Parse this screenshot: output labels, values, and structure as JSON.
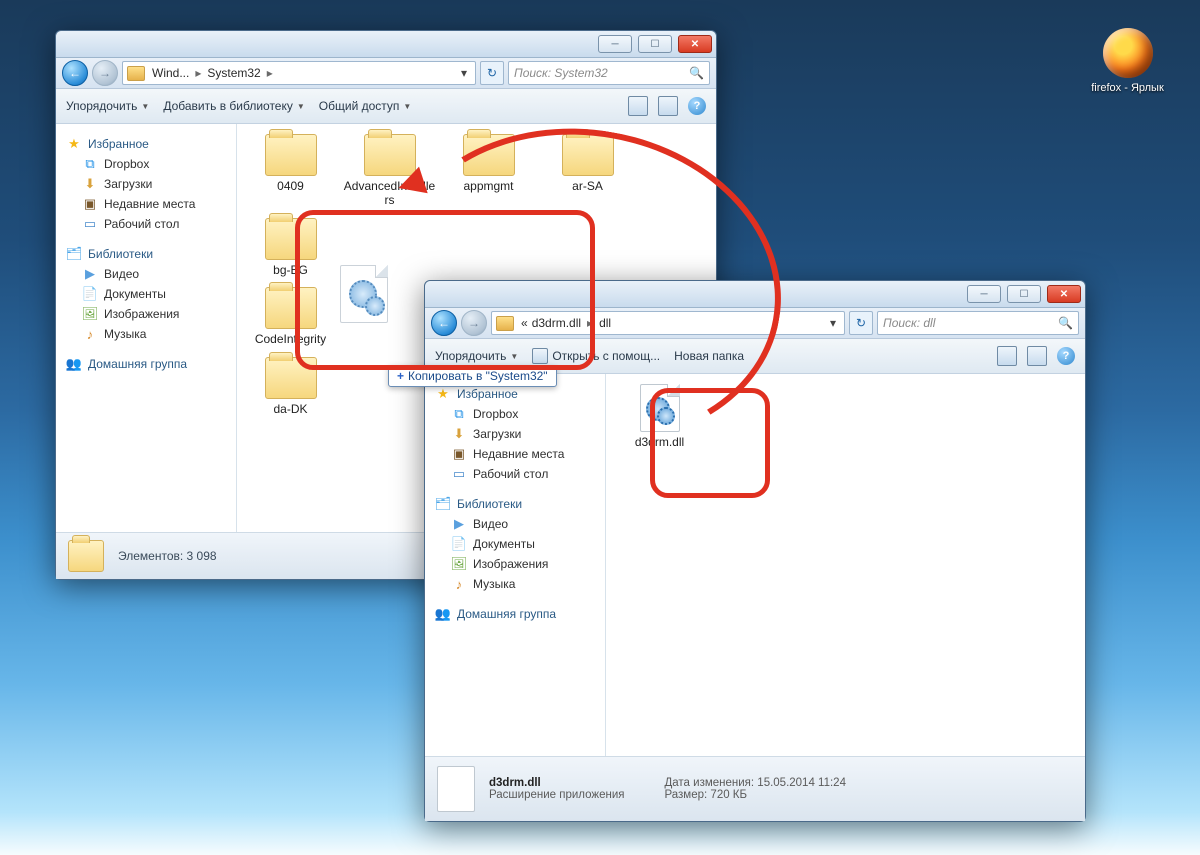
{
  "desktop": {
    "shortcut": {
      "label": "firefox -\nЯрлык"
    }
  },
  "annotation": {
    "copy_tip": "Копировать в \"System32\""
  },
  "window1": {
    "nav": {
      "crumb1": "Wind...",
      "crumb2": "System32",
      "search_placeholder": "Поиск: System32"
    },
    "cmd": {
      "organize": "Упорядочить",
      "add_lib": "Добавить в библиотеку",
      "share": "Общий доступ"
    },
    "sidebar": {
      "fav": "Избранное",
      "favs": [
        "Dropbox",
        "Загрузки",
        "Недавние места",
        "Рабочий стол"
      ],
      "lib": "Библиотеки",
      "libs": [
        "Видео",
        "Документы",
        "Изображения",
        "Музыка"
      ],
      "homegroup": "Домашняя группа"
    },
    "tiles": [
      "0409",
      "AdvancedInstallers",
      "appmgmt",
      "ar-SA",
      "bg-BG",
      "CodeIntegrity",
      "da-DK"
    ],
    "status_label": "Элементов: 3 098"
  },
  "window2": {
    "nav": {
      "crumb_pre": "«",
      "crumb1": "d3drm.dll",
      "crumb2": "dll",
      "search_placeholder": "Поиск: dll"
    },
    "cmd": {
      "organize": "Упорядочить",
      "open_with": "Открыть с помощ...",
      "new_folder": "Новая папка"
    },
    "sidebar": {
      "fav": "Избранное",
      "favs": [
        "Dropbox",
        "Загрузки",
        "Недавние места",
        "Рабочий стол"
      ],
      "lib": "Библиотеки",
      "libs": [
        "Видео",
        "Документы",
        "Изображения",
        "Музыка"
      ],
      "homegroup": "Домашняя группа"
    },
    "file": {
      "name": "d3drm.dll"
    },
    "details": {
      "name": "d3drm.dll",
      "type": "Расширение приложения",
      "date_label": "Дата изменения:",
      "date": "15.05.2014 11:24",
      "size_label": "Размер:",
      "size": "720 КБ"
    }
  }
}
